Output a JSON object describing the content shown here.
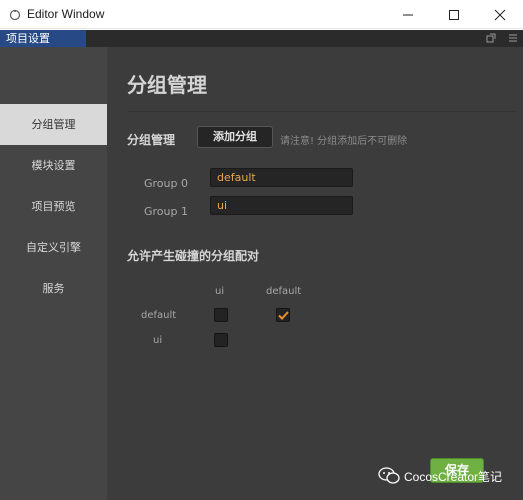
{
  "window": {
    "title": "Editor Window"
  },
  "tab": {
    "label": "项目设置"
  },
  "sidebar": {
    "items": [
      {
        "label": "分组管理",
        "active": true
      },
      {
        "label": "模块设置",
        "active": false
      },
      {
        "label": "项目预览",
        "active": false
      },
      {
        "label": "自定义引擎",
        "active": false
      },
      {
        "label": "服务",
        "active": false
      }
    ]
  },
  "page": {
    "title": "分组管理",
    "group_section_label": "分组管理",
    "add_group_button": "添加分组",
    "hint": "请注意! 分组添加后不可删除",
    "groups": [
      {
        "label": "Group 0",
        "value": "default"
      },
      {
        "label": "Group 1",
        "value": "ui"
      }
    ],
    "collision_section_label": "允许产生碰撞的分组配对",
    "matrix": {
      "columns": [
        "ui",
        "default"
      ],
      "rows": [
        {
          "label": "default",
          "checks": [
            false,
            true
          ]
        },
        {
          "label": "ui",
          "checks": [
            false
          ]
        }
      ]
    },
    "save_button": "保存"
  },
  "watermark": {
    "text": "CocosCreator笔记",
    "icon": "wechat-icon"
  },
  "colors": {
    "tab_active": "#274a86",
    "input_text": "#e8a84a",
    "check_mark": "#e8922e",
    "save_button": "#6fb043"
  }
}
